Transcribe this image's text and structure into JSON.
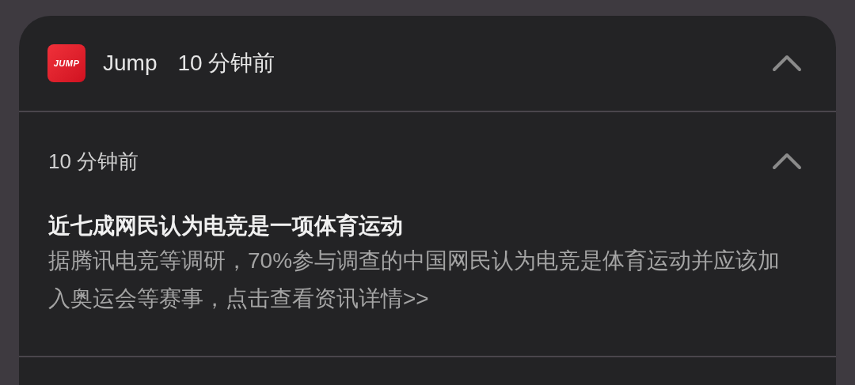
{
  "app": {
    "logo_text": "JUMP",
    "name": "Jump",
    "time": "10 分钟前",
    "expanded": true
  },
  "notification": {
    "time": "10 分钟前",
    "expanded": true,
    "title": "近七成网民认为电竞是一项体育运动",
    "body": "据腾讯电竞等调研，70%参与调查的中国网民认为电竞是体育运动并应该加入奥运会等赛事，点击查看资讯详情>>"
  }
}
